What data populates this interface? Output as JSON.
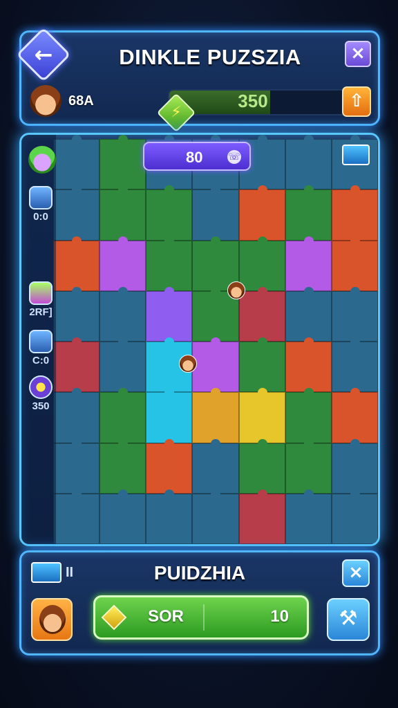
{
  "header": {
    "title": "DINKLE PUZSZIA",
    "back_icon": "arrow-left-icon",
    "close_icon": "close-icon",
    "player": {
      "name": "68A",
      "avatar_icon": "player-avatar-icon"
    },
    "energy": {
      "value": "350",
      "fill_fraction": 0.55,
      "icon": "lightning-gem-icon"
    },
    "upgrade_icon": "arrow-up-icon"
  },
  "board": {
    "score": "80",
    "score_icon": "phone-icon",
    "toolbox_icon": "toolbox-icon",
    "side_items": [
      {
        "icon": "goblin-avatar-icon",
        "label": ""
      },
      {
        "icon": "book-icon",
        "label": "0:0"
      },
      {
        "icon": "wand-icon",
        "label": "2RF]"
      },
      {
        "icon": "book-icon",
        "label": "C:0"
      },
      {
        "icon": "star-icon",
        "label": "350"
      }
    ],
    "grid_colors": [
      [
        "#2b6a8e",
        "#2f8a3e",
        "#2b6a8e",
        "#2b6a8e",
        "#2b6a8e",
        "#2b6a8e",
        "#2b6a8e"
      ],
      [
        "#2b6a8e",
        "#2f8a3e",
        "#2f8a3e",
        "#2b6a8e",
        "#d9542a",
        "#2f8a3e",
        "#d9542a"
      ],
      [
        "#d9542a",
        "#b35be6",
        "#2f8a3e",
        "#2f8a3e",
        "#2f8a3e",
        "#b35be6",
        "#d9542a"
      ],
      [
        "#2b6a8e",
        "#2b6a8e",
        "#8f5ef0",
        "#2f8a3e",
        "#b63d49",
        "#2b6a8e",
        "#2b6a8e"
      ],
      [
        "#b63d49",
        "#2b6a8e",
        "#27c3e6",
        "#b35be6",
        "#2f8a3e",
        "#d9542a",
        "#2b6a8e"
      ],
      [
        "#2b6a8e",
        "#2f8a3e",
        "#27c3e6",
        "#e0a22b",
        "#e6c62a",
        "#2f8a3e",
        "#d9542a"
      ],
      [
        "#2b6a8e",
        "#2f8a3e",
        "#d9542a",
        "#2b6a8e",
        "#2f8a3e",
        "#2f8a3e",
        "#2b6a8e"
      ],
      [
        "#2b6a8e",
        "#2b6a8e",
        "#2b6a8e",
        "#2b6a8e",
        "#b63d49",
        "#2b6a8e",
        "#2b6a8e"
      ]
    ]
  },
  "footer": {
    "title": "PUIDZHIA",
    "tool_icon": "toolbox-icon",
    "tool_count": "II",
    "close_icon": "close-icon",
    "avatar_icon": "player-avatar-icon",
    "sort_label": "SOR",
    "sort_value": "10",
    "sort_icon": "gem-icon",
    "hammer_icon": "hammer-icon"
  }
}
